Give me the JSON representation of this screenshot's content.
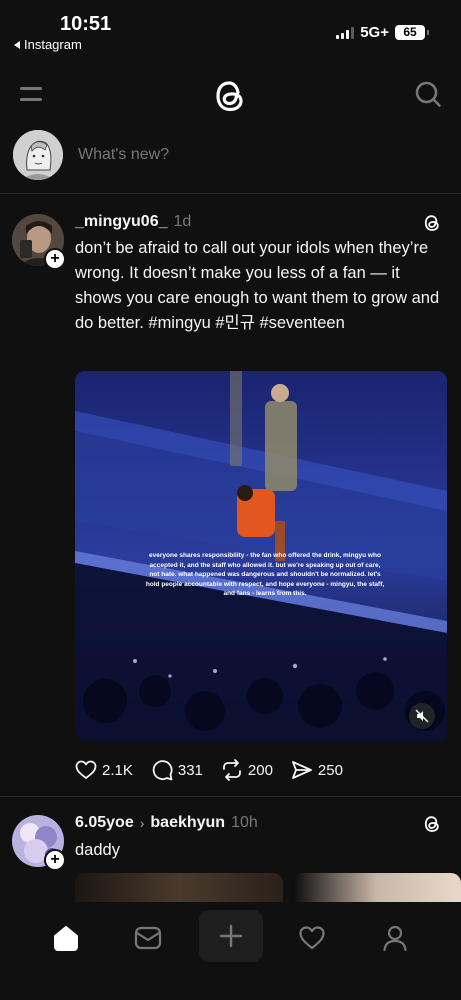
{
  "status_bar": {
    "time": "10:51",
    "back_app": "Instagram",
    "network": "5G+",
    "battery": "65"
  },
  "composer": {
    "placeholder": "What's new?"
  },
  "posts": [
    {
      "username": "_mingyu06_",
      "time": "1d",
      "text": "don’t be afraid to call out your idols when they’re wrong. It doesn’t make you less of a fan — it shows you care enough to want them to grow and do better. #mingyu #민규 #seventeen",
      "media_caption": "everyone shares responsibility - the fan who offered the drink, mingyu who accepted it, and the staff who allowed it. but we're speaking up out of care, not hate. what happened was dangerous and shouldn't be normalized. let's hold people accountable with respect, and hope everyone - mingyu, the staff, and fans - learns from this.",
      "likes": "2.1K",
      "replies": "331",
      "reposts": "200",
      "shares": "250"
    },
    {
      "username": "6.05yoe",
      "reposted_to": "baekhyun",
      "time": "10h",
      "text": "daddy"
    }
  ],
  "icons": {
    "menu": "menu-icon",
    "logo": "threads-logo-icon",
    "search": "search-icon",
    "like": "heart-icon",
    "reply": "comment-icon",
    "repost": "repost-icon",
    "share": "send-icon",
    "mute": "speaker-muted-icon",
    "tabs": [
      "home-icon",
      "inbox-icon",
      "plus-icon",
      "heart-icon",
      "profile-icon"
    ]
  },
  "colors": {
    "background": "#101010",
    "text": "#f3f5f7",
    "secondary_text": "#777777",
    "divider": "#2a2a2a"
  }
}
